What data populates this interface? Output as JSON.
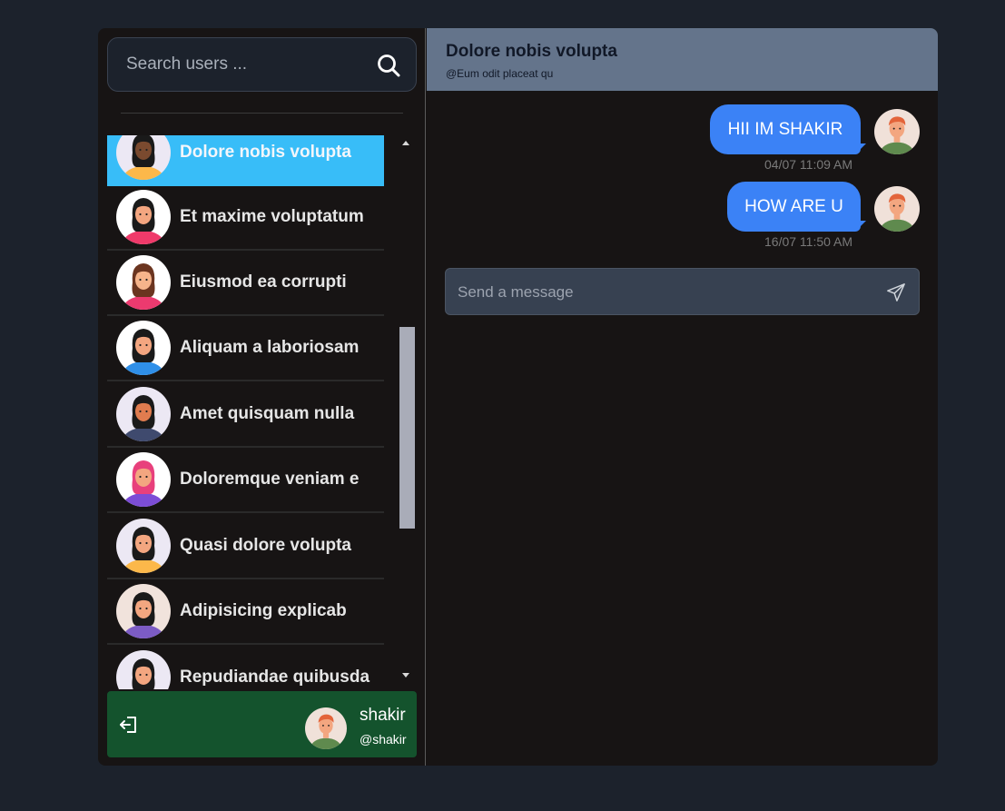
{
  "search": {
    "placeholder": "Search users ...",
    "icon": "search-icon"
  },
  "users": [
    {
      "name": "Dolore nobis volupta",
      "active": true,
      "avatar_bg": "#ece8f4",
      "skin": "#7a4a2f",
      "hair": "#1a1a1a",
      "shirt": "#fcb84a"
    },
    {
      "name": "Et maxime voluptatum",
      "active": false,
      "avatar_bg": "#ffffff",
      "skin": "#f3a680",
      "hair": "#1a1a1a",
      "shirt": "#ef3a6a"
    },
    {
      "name": "Eiusmod ea corrupti",
      "active": false,
      "avatar_bg": "#ffffff",
      "skin": "#f6b48b",
      "hair": "#6b3520",
      "shirt": "#ec3a6f"
    },
    {
      "name": "Aliquam a laboriosam",
      "active": false,
      "avatar_bg": "#ffffff",
      "skin": "#f3a680",
      "hair": "#1a1a1a",
      "shirt": "#2f8fe8"
    },
    {
      "name": "Amet quisquam nulla",
      "active": false,
      "avatar_bg": "#ece8f4",
      "skin": "#e07c4f",
      "hair": "#1a1a1a",
      "shirt": "#3f4a6e"
    },
    {
      "name": "Doloremque veniam e",
      "active": false,
      "avatar_bg": "#ffffff",
      "skin": "#f3a680",
      "hair": "#e8407c",
      "shirt": "#7c4dd6"
    },
    {
      "name": "Quasi dolore volupta",
      "active": false,
      "avatar_bg": "#ece8f4",
      "skin": "#f3a680",
      "hair": "#1a1a1a",
      "shirt": "#fcb84a"
    },
    {
      "name": "Adipisicing explicab",
      "active": false,
      "avatar_bg": "#f1e3dc",
      "skin": "#f3a680",
      "hair": "#1a1a1a",
      "shirt": "#7c5cc4"
    },
    {
      "name": "Repudiandae quibusda",
      "active": false,
      "avatar_bg": "#ece8f4",
      "skin": "#f3a680",
      "hair": "#1a1a1a",
      "shirt": "#e8e8e8"
    }
  ],
  "profile": {
    "name": "shakir",
    "handle": "@shakir",
    "logout_icon": "logout-icon"
  },
  "chat": {
    "title": "Dolore nobis volupta",
    "subtitle": "@Eum odit placeat qu",
    "messages": [
      {
        "text": "HII IM SHAKIR",
        "time": "04/07 11:09 AM"
      },
      {
        "text": "HOW ARE U",
        "time": "16/07 11:50 AM"
      }
    ],
    "composer_placeholder": "Send a message",
    "send_icon": "send-icon"
  },
  "colors": {
    "accent_active": "#38bdf8",
    "bubble": "#3b82f6",
    "header": "#64748b",
    "profile_bar": "#14532d"
  }
}
